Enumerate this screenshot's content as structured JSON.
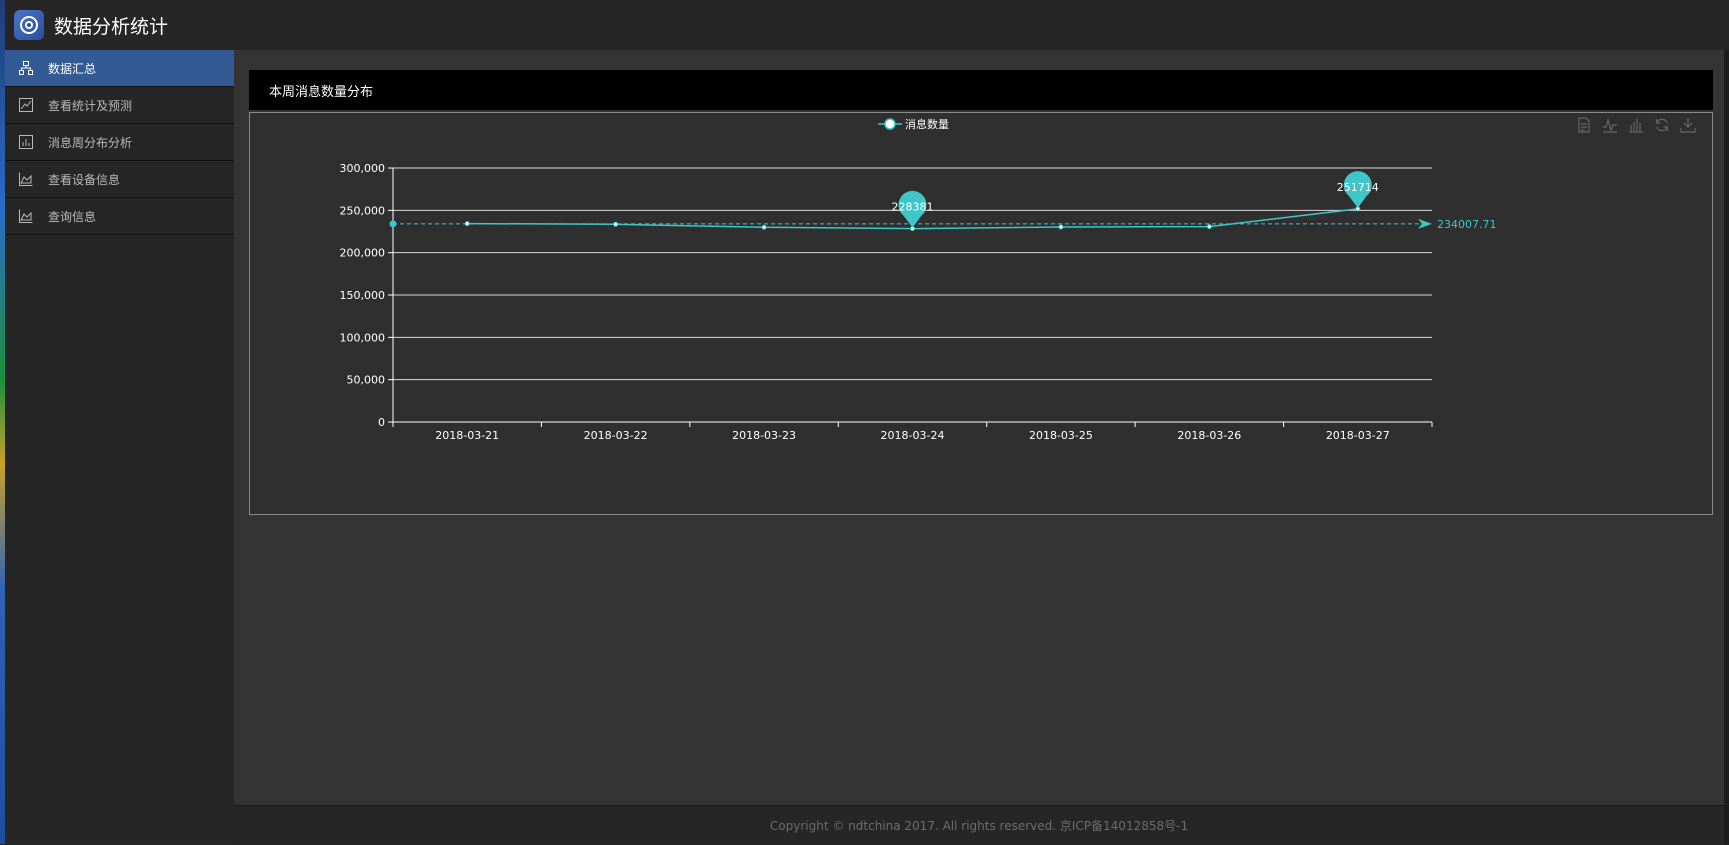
{
  "app": {
    "title": "数据分析统计"
  },
  "sidebar": {
    "items": [
      {
        "label": "数据汇总",
        "icon": "sitemap-icon",
        "active": true
      },
      {
        "label": "查看统计及预测",
        "icon": "line-chart-icon",
        "active": false
      },
      {
        "label": "消息周分布分析",
        "icon": "bar-chart-icon",
        "active": false
      },
      {
        "label": "查看设备信息",
        "icon": "area-chart-icon",
        "active": false
      },
      {
        "label": "查询信息",
        "icon": "area-chart-icon",
        "active": false
      }
    ]
  },
  "panel": {
    "title": "本周消息数量分布"
  },
  "footer": {
    "text": "Copyright © ndtchina 2017. All rights reserved. 京ICP备14012858号-1"
  },
  "colors": {
    "accent": "#3ec6c9",
    "active_nav": "#345a94"
  },
  "chart_data": {
    "type": "line",
    "title": "",
    "legend": [
      "消息数量"
    ],
    "legend_position": "top-center",
    "categories": [
      "2018-03-21",
      "2018-03-22",
      "2018-03-23",
      "2018-03-24",
      "2018-03-25",
      "2018-03-26",
      "2018-03-27"
    ],
    "series": [
      {
        "name": "消息数量",
        "values": [
          234300,
          233500,
          230000,
          228381,
          230300,
          230800,
          251714
        ]
      }
    ],
    "ylim": [
      0,
      300000
    ],
    "yticks": [
      "0",
      "50,000",
      "100,000",
      "150,000",
      "200,000",
      "250,000",
      "300,000"
    ],
    "grid": true,
    "mark_points": [
      {
        "category": "2018-03-24",
        "value": 228381,
        "label": "228381",
        "kind": "min"
      },
      {
        "category": "2018-03-27",
        "value": 251714,
        "label": "251714",
        "kind": "max"
      }
    ],
    "mark_line": {
      "value": 234007.71,
      "label": "234007.71",
      "kind": "average"
    }
  }
}
